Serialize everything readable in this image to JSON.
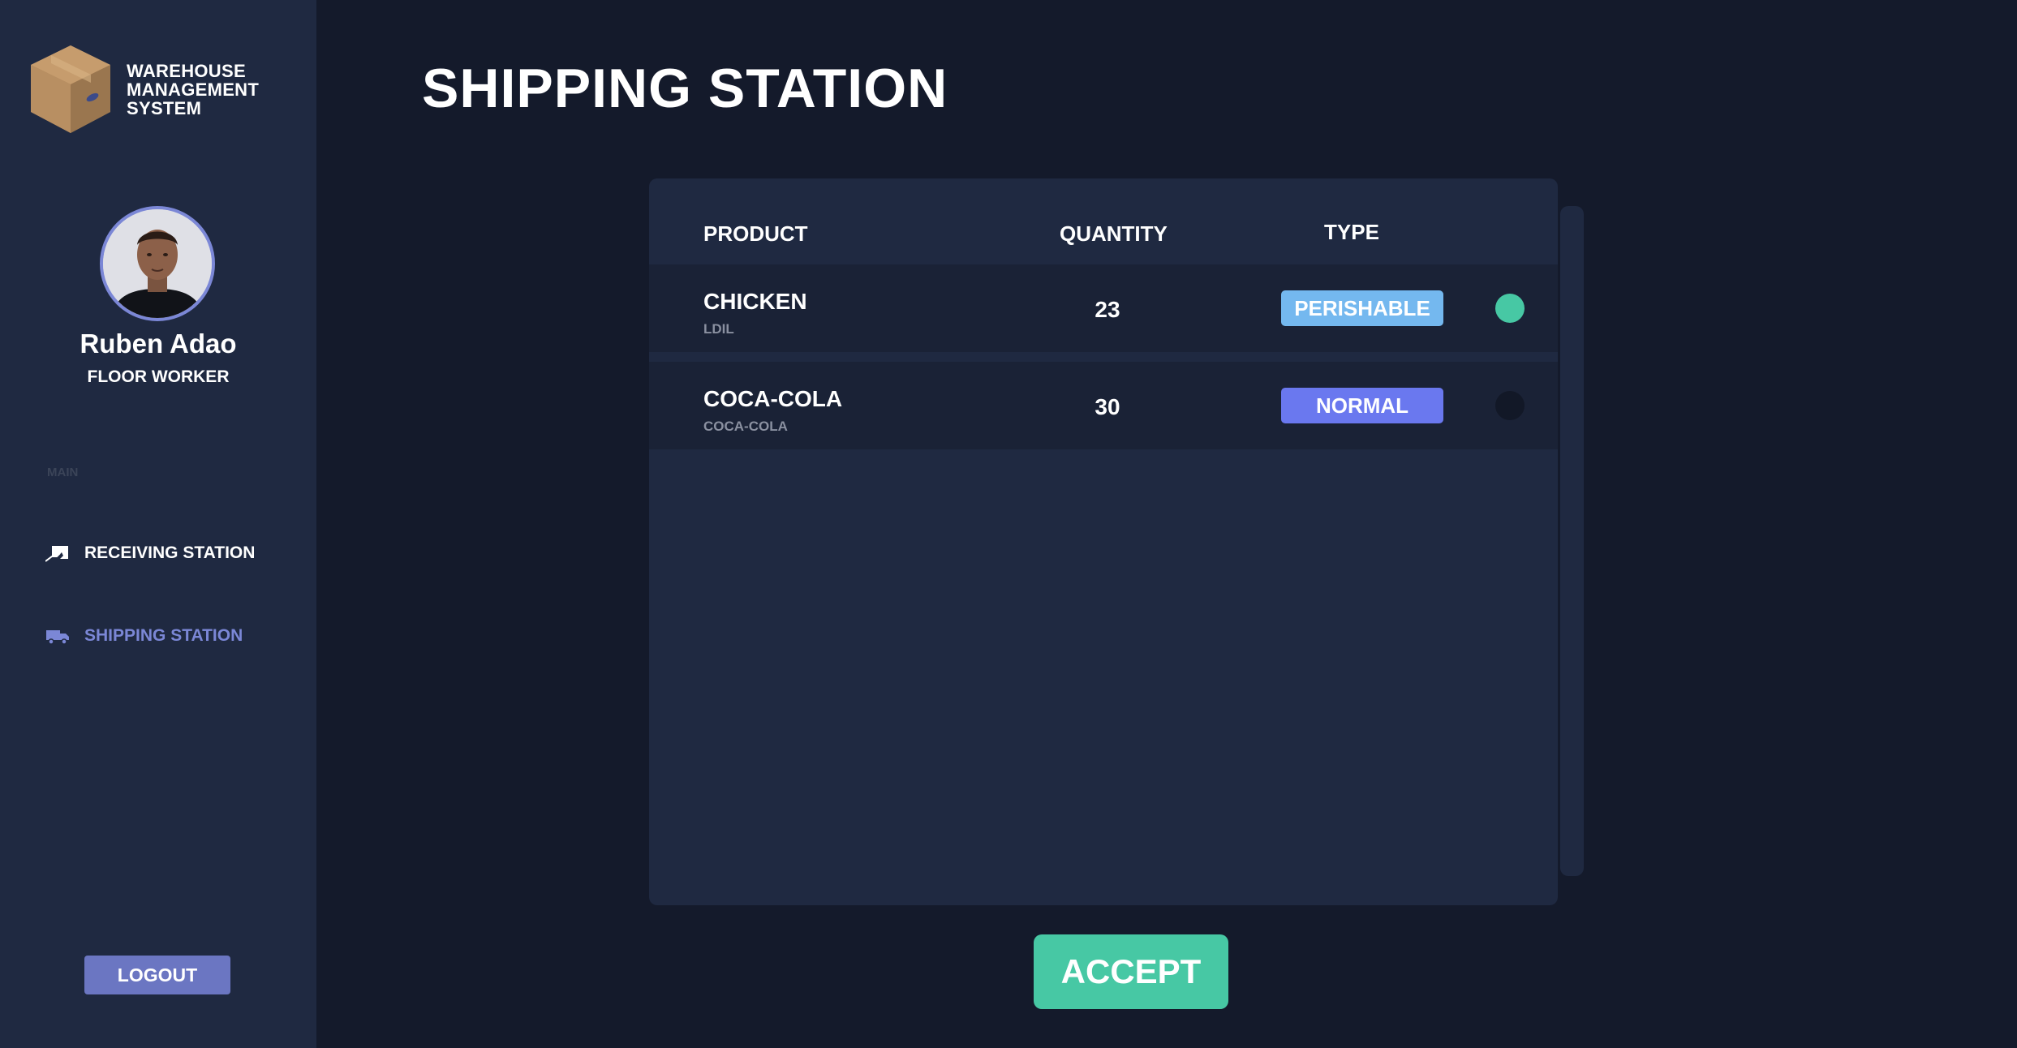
{
  "brand": {
    "line1": "WAREHOUSE",
    "line2": "MANAGEMENT",
    "line3": "SYSTEM",
    "logo_icon": "cardboard-box-icon"
  },
  "user": {
    "name": "Ruben Adao",
    "role": "FLOOR WORKER"
  },
  "sidebar": {
    "section_label": "MAIN",
    "items": [
      {
        "label": "RECEIVING STATION",
        "icon": "receiving-icon",
        "active": false
      },
      {
        "label": "SHIPPING STATION",
        "icon": "truck-icon",
        "active": true
      }
    ],
    "logout_label": "LOGOUT"
  },
  "page": {
    "title": "SHIPPING STATION"
  },
  "table": {
    "columns": [
      "PRODUCT",
      "QUANTITY",
      "TYPE"
    ],
    "rows": [
      {
        "product": "CHICKEN",
        "brand": "LDIL",
        "quantity": "23",
        "type": "PERISHABLE",
        "selected": true
      },
      {
        "product": "COCA-COLA",
        "brand": "COCA-COLA",
        "quantity": "30",
        "type": "NORMAL",
        "selected": false
      }
    ]
  },
  "actions": {
    "accept_label": "ACCEPT"
  },
  "colors": {
    "background": "#141a2b",
    "panel": "#1f2941",
    "accent": "#7b87d6",
    "perishable": "#74b8ef",
    "normal": "#6a78ef",
    "success": "#47c8a4"
  }
}
